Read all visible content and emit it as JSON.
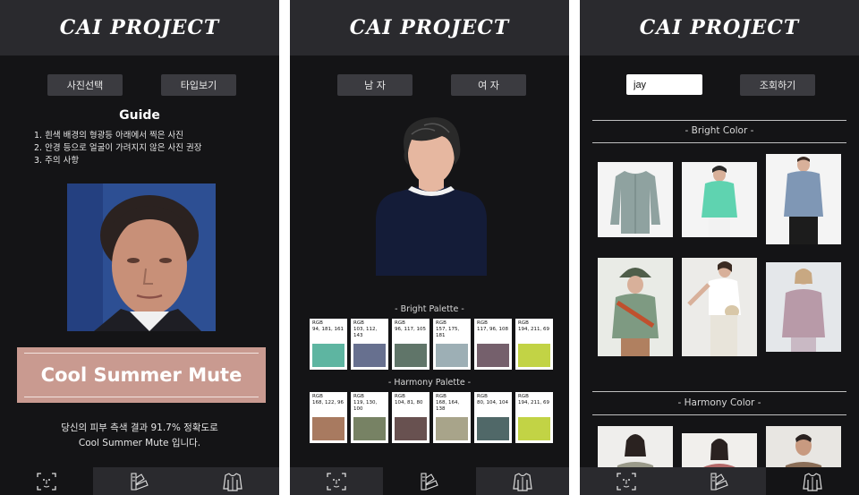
{
  "app": {
    "logo": "CAI PROJECT"
  },
  "screen1": {
    "buttons": {
      "select_photo": "사진선택",
      "view_type": "타입보기"
    },
    "guide_title": "Guide",
    "guide_items": [
      "1. 흰색 배경의 형광등 아래에서 찍은 사진",
      "2. 안경 등으로 얼굴이 가려지지 않은 사진 권장",
      "3. 주의 사항"
    ],
    "result": "Cool Summer Mute",
    "result_desc_line1": "당신의 피부 측색 결과 91.7% 정확도로",
    "result_desc_line2": "Cool Summer Mute 입니다."
  },
  "screen2": {
    "buttons": {
      "male": "남 자",
      "female": "여 자"
    },
    "bright_title": "- Bright Palette -",
    "harmony_title": "- Harmony Palette -",
    "bright_palette": [
      {
        "label": "RGB",
        "rgb": "94, 181, 161",
        "color": "#5eb5a1"
      },
      {
        "label": "RGB",
        "rgb": "103, 112, 143",
        "color": "#67708f"
      },
      {
        "label": "RGB",
        "rgb": "96, 117, 105",
        "color": "#607569"
      },
      {
        "label": "RGB",
        "rgb": "157, 175, 181",
        "color": "#9dafb5"
      },
      {
        "label": "RGB",
        "rgb": "117, 96, 108",
        "color": "#75606c"
      },
      {
        "label": "RGB",
        "rgb": "194, 211, 69",
        "color": "#c2d345"
      }
    ],
    "harmony_palette": [
      {
        "label": "RGB",
        "rgb": "168, 122, 96",
        "color": "#a87a60"
      },
      {
        "label": "RGB",
        "rgb": "119, 130, 100",
        "color": "#778264"
      },
      {
        "label": "RGB",
        "rgb": "104, 81, 80",
        "color": "#685150"
      },
      {
        "label": "RGB",
        "rgb": "168, 164, 138",
        "color": "#a8a48a"
      },
      {
        "label": "RGB",
        "rgb": "80, 104, 104",
        "color": "#506868"
      },
      {
        "label": "RGB",
        "rgb": "194, 211, 69",
        "color": "#c2d345"
      }
    ]
  },
  "screen3": {
    "search_value": "jay",
    "search_button": "조회하기",
    "bright_title": "- Bright Color -",
    "harmony_title": "- Harmony Color -"
  },
  "colors": {
    "header": "#2a2a2e",
    "background": "#141416",
    "button": "#3b3b40",
    "result_box": "#c99a90"
  },
  "icons": {
    "nav1": "face-scan-icon",
    "nav2": "color-fan-icon",
    "nav3": "jacket-icon"
  }
}
